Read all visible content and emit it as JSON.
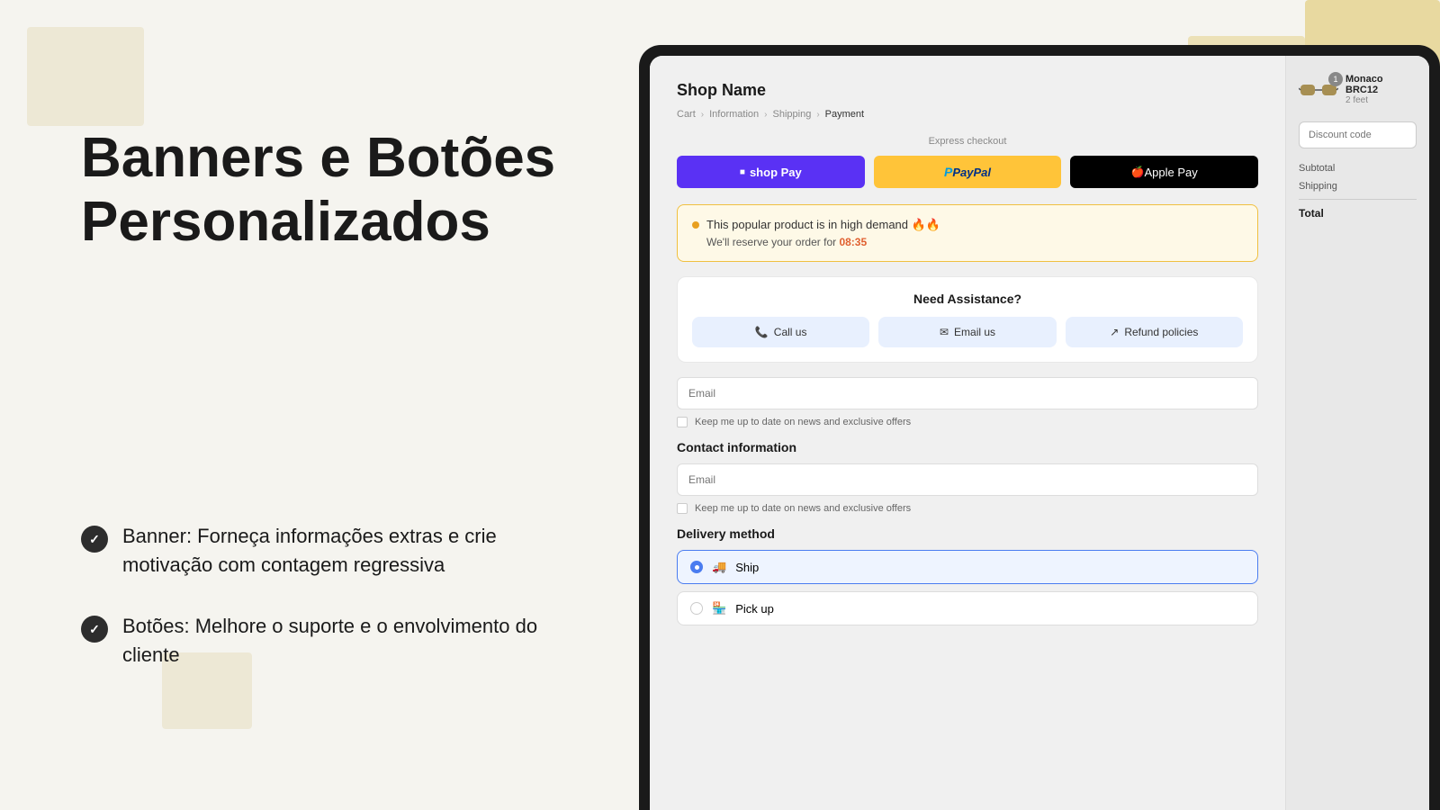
{
  "left": {
    "heading_line1": "Banners e Botões",
    "heading_line2": "Personalizados",
    "features": [
      {
        "id": "feature-1",
        "text": "Banner: Forneça informações extras e crie motivação com contagem regressiva"
      },
      {
        "id": "feature-2",
        "text": "Botões: Melhore o suporte e o envolvimento do cliente"
      }
    ]
  },
  "checkout": {
    "shop_name": "Shop Name",
    "breadcrumbs": [
      "Cart",
      "Information",
      "Shipping",
      "Payment"
    ],
    "express_checkout_label": "Express checkout",
    "buttons": {
      "shoppay": "shop Pay",
      "paypal": "PayPal",
      "applepay": "Apple Pay"
    },
    "banner": {
      "text": "This popular product is in high demand 🔥🔥",
      "subtext": "We'll reserve your order for",
      "timer": "08:35"
    },
    "assistance": {
      "title": "Need Assistance?",
      "buttons": [
        "Call us",
        "Email us",
        "Refund policies"
      ]
    },
    "form": {
      "email_placeholder": "Email",
      "checkbox_label": "Keep me up to date on news and exclusive offers",
      "contact_section": "Contact information",
      "email2_placeholder": "Email",
      "checkbox2_label": "Keep me up to date on news and exclusive offers",
      "delivery_section": "Delivery method",
      "delivery_options": [
        {
          "label": "Ship",
          "selected": true
        },
        {
          "label": "Pick up",
          "selected": false
        }
      ]
    }
  },
  "sidebar": {
    "product_name": "Monaco BRC12",
    "product_desc": "2 feet",
    "product_badge": "1",
    "discount_placeholder": "Discount code",
    "subtotal_label": "Subtotal",
    "shipping_label": "Shipping",
    "total_label": "Total"
  }
}
